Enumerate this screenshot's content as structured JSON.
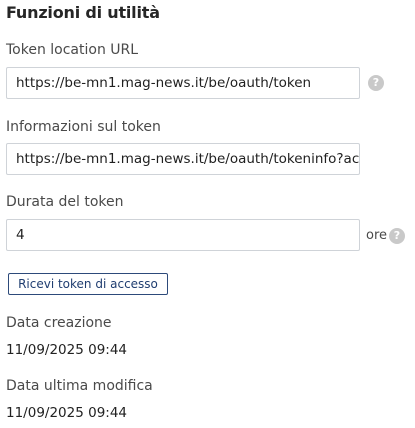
{
  "section": {
    "title": "Funzioni di utilità"
  },
  "fields": {
    "token_location": {
      "label": "Token location URL",
      "value": "https://be-mn1.mag-news.it/be/oauth/token"
    },
    "token_info": {
      "label": "Informazioni sul token",
      "value": "https://be-mn1.mag-news.it/be/oauth/tokeninfo?ac"
    },
    "token_duration": {
      "label": "Durata del token",
      "value": "4",
      "unit": "ore"
    }
  },
  "help_icon": {
    "glyph": "?",
    "icon": "help-icon"
  },
  "actions": {
    "get_token_label": "Ricevi token di accesso"
  },
  "meta": {
    "created_label": "Data creazione",
    "created_value": "11/09/2025 09:44",
    "modified_label": "Data ultima modifica",
    "modified_value": "11/09/2025 09:44"
  }
}
